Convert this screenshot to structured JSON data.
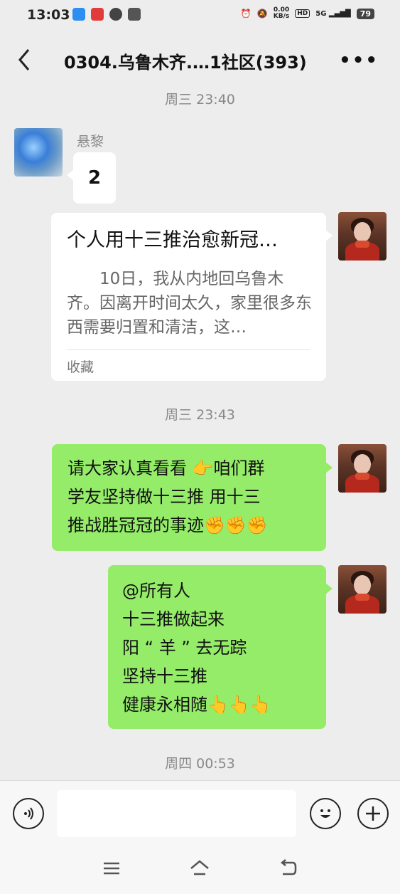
{
  "status_bar": {
    "time": "13:03",
    "net_speed": "0.00\nKB/s",
    "hd_label": "HD",
    "signal_label": "5G",
    "battery": "79"
  },
  "header": {
    "title": "0304.乌鲁木齐.…1社区(393)",
    "back_icon": "chevron-left-icon",
    "more_icon": "ellipsis-icon"
  },
  "chat": {
    "timestamps": [
      "周三 23:40",
      "周三 23:43",
      "周四 00:53"
    ],
    "messages": [
      {
        "sender": "悬黎",
        "text": "2",
        "type": "text",
        "side": "left"
      },
      {
        "type": "link_card",
        "side": "right",
        "card_title": "个人用十三推治愈新冠…",
        "card_desc": "10日，我从内地回乌鲁木齐。因离开时间太久，家里很多东西需要归置和清洁，这…",
        "card_footer": "收藏"
      },
      {
        "type": "text",
        "side": "right",
        "lines": [
          "请大家认真看看 👉咱们群",
          "学友坚持做十三推  用十三",
          "推战胜冠冠的事迹✊✊✊"
        ]
      },
      {
        "type": "text",
        "side": "right",
        "lines": [
          "@所有人",
          "十三推做起来",
          "阳 “ 羊 ” 去无踪",
          "坚持十三推",
          "健康永相随👆👆👆"
        ]
      }
    ]
  },
  "input_bar": {
    "voice_icon": "voice-icon",
    "emoji_icon": "emoji-icon",
    "add_icon": "plus-icon",
    "placeholder": ""
  },
  "nav_bar": {
    "menu_icon": "menu-icon",
    "home_icon": "home-icon",
    "back_icon": "back-icon"
  }
}
